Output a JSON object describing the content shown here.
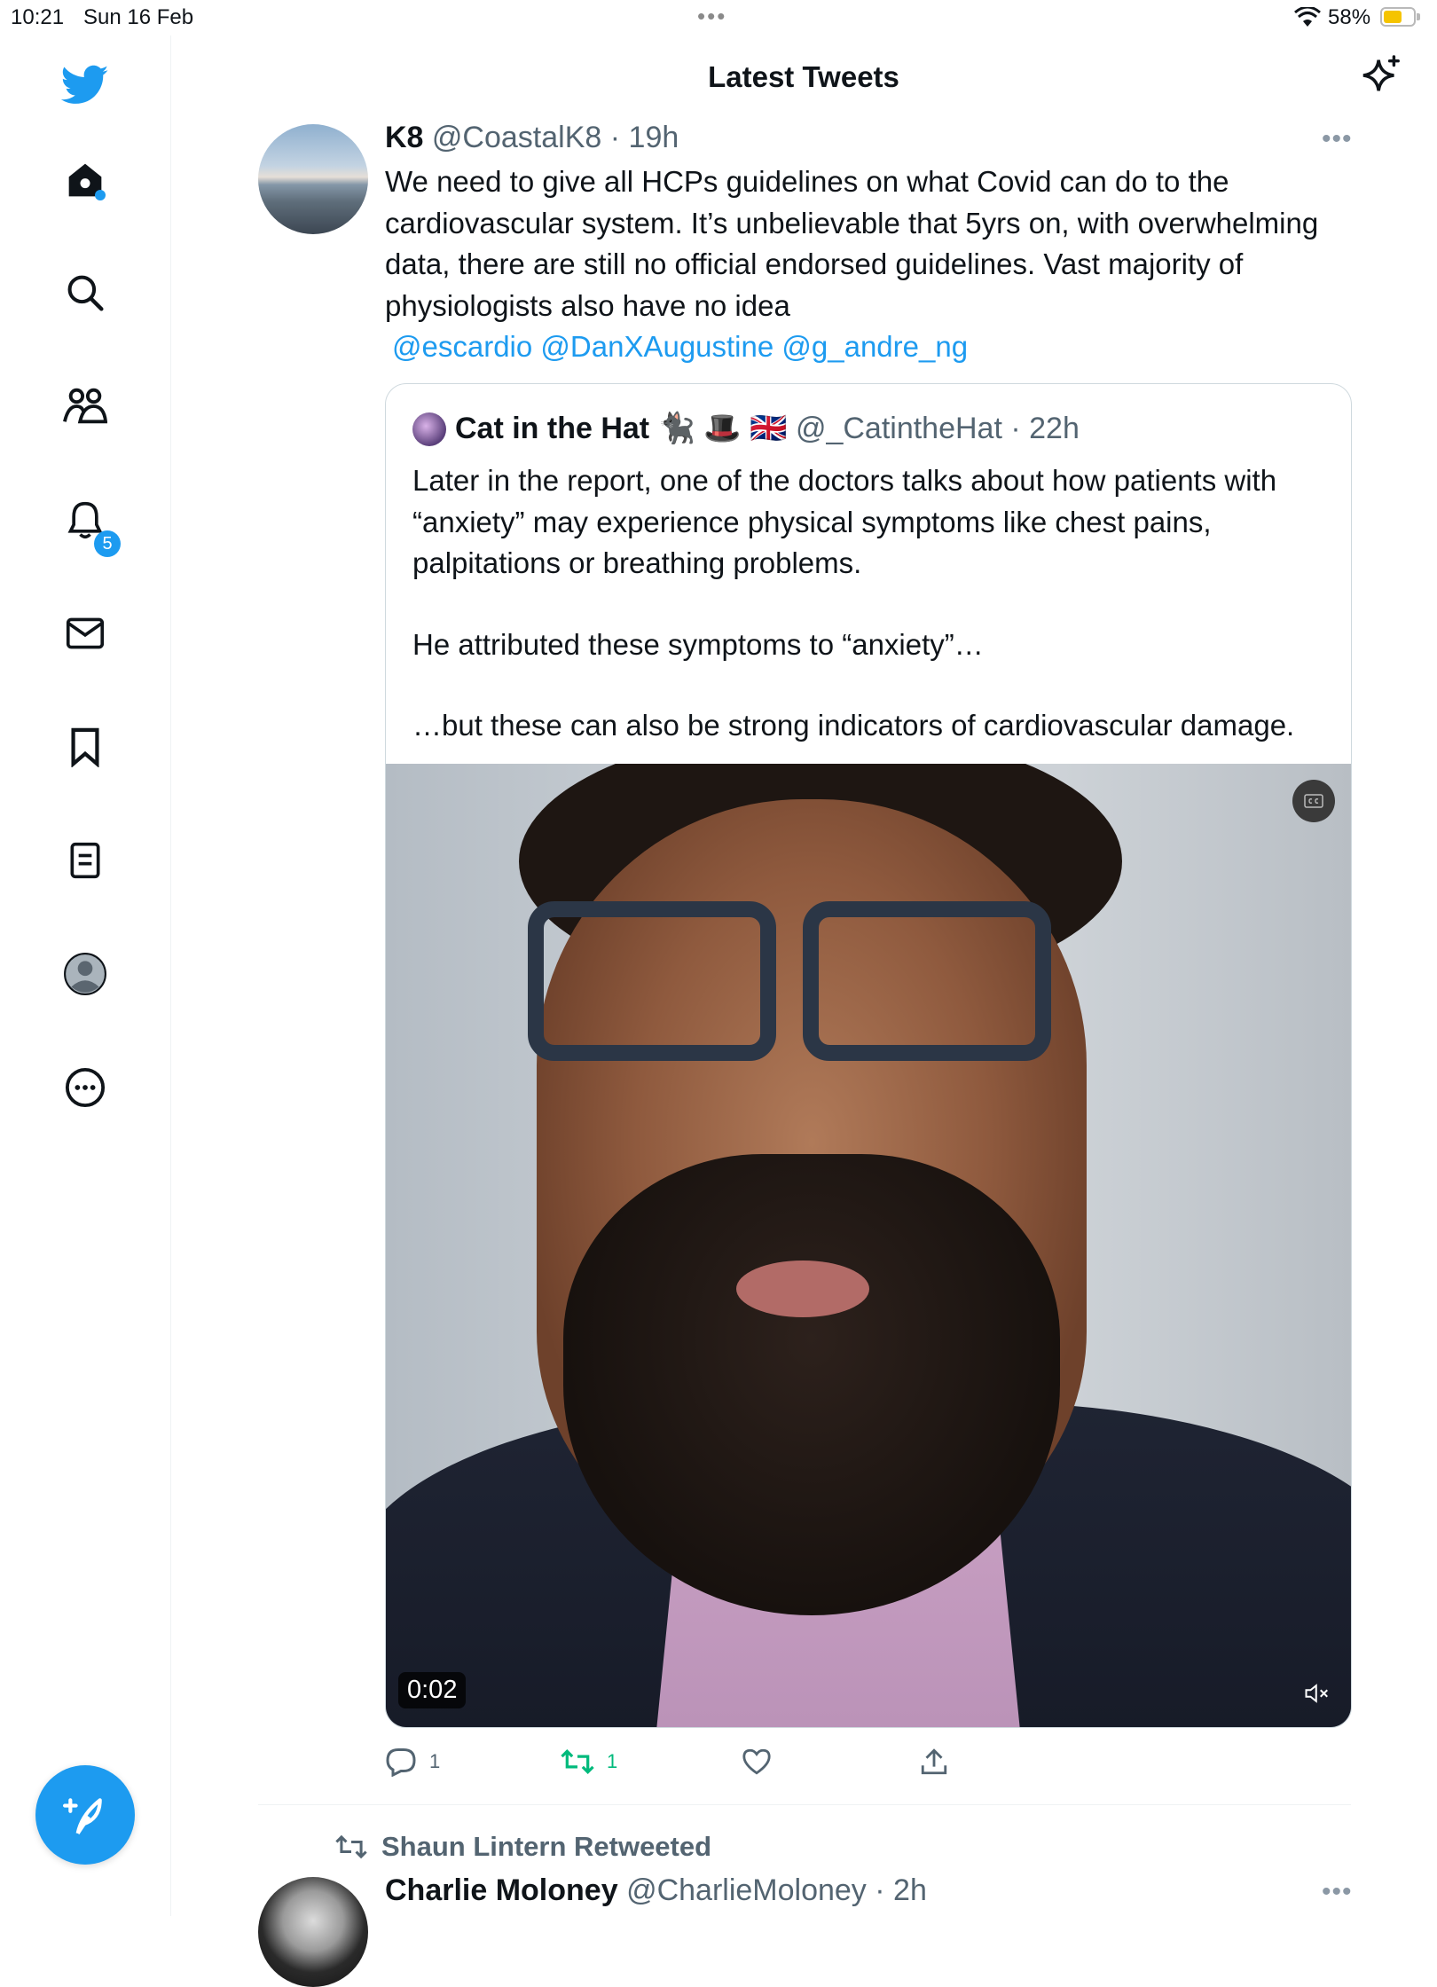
{
  "status_bar": {
    "time": "10:21",
    "date": "Sun 16 Feb",
    "dots": "•••",
    "battery": "58%"
  },
  "sidebar": {
    "items": [
      "twitter-logo",
      "home",
      "explore",
      "communities",
      "notifications",
      "messages",
      "bookmarks",
      "lists",
      "profile",
      "more"
    ],
    "notifications_count": "5"
  },
  "header": {
    "title": "Latest Tweets"
  },
  "tweet": {
    "name": "K8",
    "handle": "@CoastalK8",
    "time": "19h",
    "body": "We need to give all HCPs guidelines on what Covid can do to the cardiovascular system. It’s unbelievable that 5yrs on, with overwhelming data, there are still no official endorsed guidelines. Vast majority of physiologists also have no idea",
    "mentions": "@escardio @DanXAugustine @g_andre_ng",
    "more": "•••",
    "quote": {
      "name": "Cat in the Hat",
      "emoji": "🐈‍⬛ 🎩 🇬🇧",
      "handle": "@_CatintheHat",
      "time": "22h",
      "p1": "Later in the report, one of the doctors talks about how patients with “anxiety” may experience physical symptoms like chest pains, palpitations or breathing problems.",
      "p2": "He attributed these symptoms to “anxiety”…",
      "p3": "…but these can also be strong indicators of cardiovascular damage.",
      "video_time": "0:02"
    },
    "reply_count": "1",
    "retweet_count": "1"
  },
  "next": {
    "retweeted_by": "Shaun Lintern Retweeted",
    "name": "Charlie Moloney",
    "handle": "@CharlieMoloney",
    "time": "2h",
    "more": "•••"
  },
  "colors": {
    "accent": "#1d9bf0",
    "retweet_green": "#00ba7c",
    "muted": "#536471"
  }
}
